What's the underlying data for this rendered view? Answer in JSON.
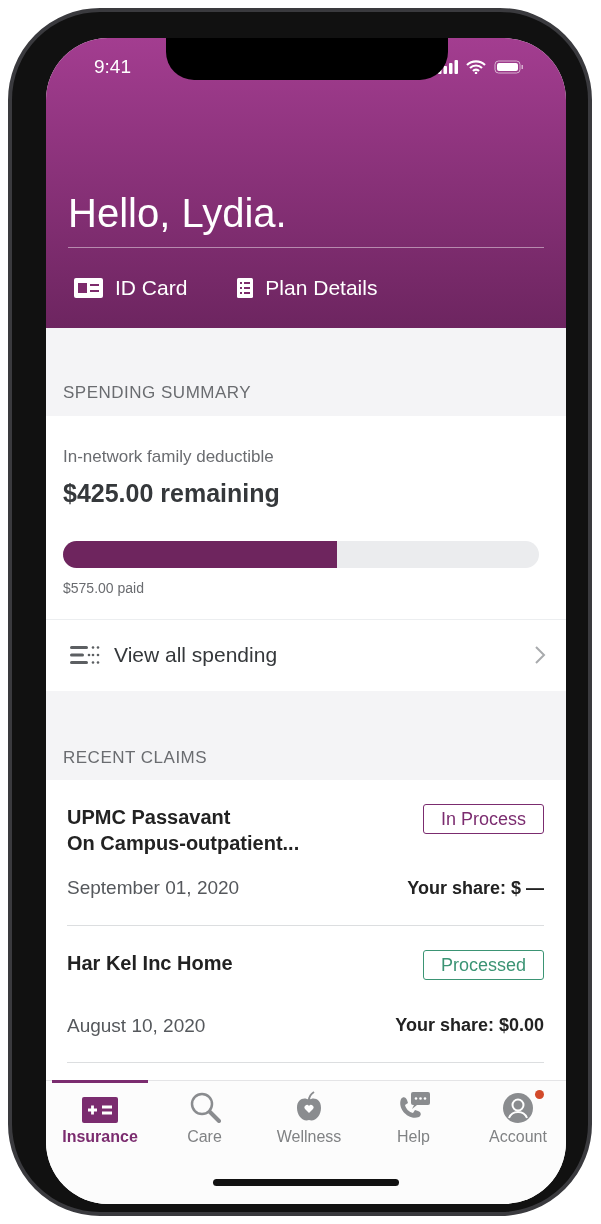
{
  "status_bar": {
    "time": "9:41"
  },
  "header": {
    "greeting": "Hello, Lydia.",
    "links": [
      {
        "kind": "id",
        "label": "ID Card"
      },
      {
        "kind": "plan",
        "label": "Plan Details"
      }
    ]
  },
  "spending_summary": {
    "heading": "SPENDING SUMMARY",
    "label": "In-network family deductible",
    "amount": "$425.00 remaining",
    "level": 0.575,
    "paid": "$575.00 paid",
    "link": "View all spending"
  },
  "recent_claims": {
    "heading": "RECENT CLAIMS",
    "claims": [
      {
        "name": "UPMC Passavant\nOn Campus-outpatient...",
        "status": "In Process",
        "color": "#7b2c6f",
        "date": "September 01, 2020",
        "share": "Your share: $ —"
      },
      {
        "name": "Har Kel Inc Home",
        "status": "Processed",
        "color": "#3b9474",
        "date": "August 10, 2020",
        "share": "Your share: $0.00"
      }
    ]
  },
  "tab_bar": [
    {
      "kind": "insurance",
      "label": "Insurance",
      "selected": true,
      "notification": false
    },
    {
      "kind": "care",
      "label": "Care",
      "selected": false,
      "notification": false
    },
    {
      "kind": "wellness",
      "label": "Wellness",
      "selected": false,
      "notification": false
    },
    {
      "kind": "help",
      "label": "Help",
      "selected": false,
      "notification": false
    },
    {
      "kind": "account",
      "label": "Account",
      "selected": false,
      "notification": true
    }
  ]
}
